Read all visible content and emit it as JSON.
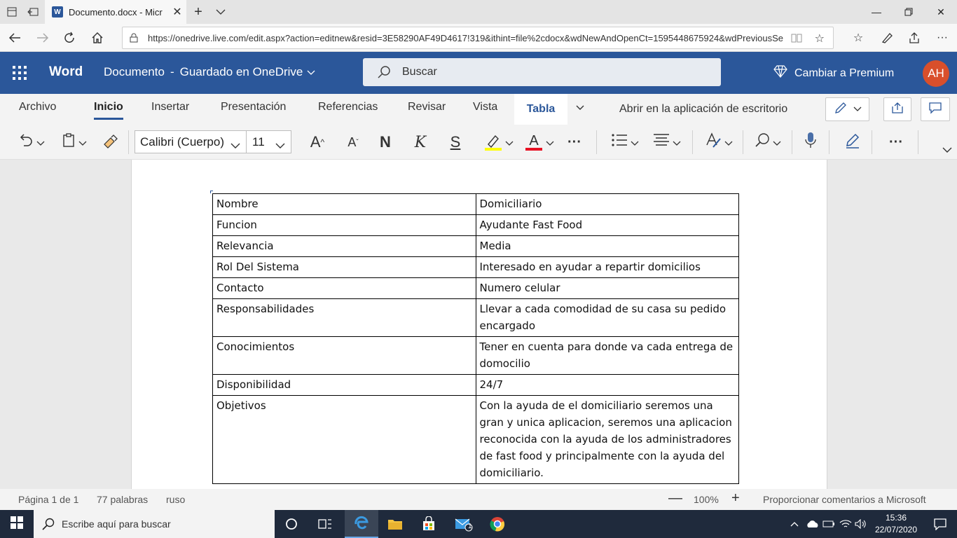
{
  "browser": {
    "tab_title": "Documento.docx - Micr",
    "tab_icon_letter": "W",
    "url": "https://onedrive.live.com/edit.aspx?action=editnew&resid=3E58290AF49D4617!319&ithint=file%2cdocx&wdNewAndOpenCt=1595448675924&wdPreviousSe"
  },
  "word": {
    "app_name": "Word",
    "doc_title": "Documento",
    "save_status": "Guardado en OneDrive",
    "title_separator": "-",
    "search_placeholder": "Buscar",
    "premium_label": "Cambiar a Premium",
    "avatar_initials": "AH",
    "brand_color": "#2b579a"
  },
  "ribbon": {
    "tabs": [
      "Archivo",
      "Inicio",
      "Insertar",
      "Presentación",
      "Referencias",
      "Revisar",
      "Vista",
      "Tabla"
    ],
    "active_tab": "Inicio",
    "context_tab": "Tabla",
    "open_desktop": "Abrir en la aplicación de escritorio",
    "font_name": "Calibri (Cuerpo)",
    "font_size": "11",
    "bold_label": "N",
    "italic_label": "K",
    "strike_label": "S",
    "grow_font": "A",
    "shrink_font": "A",
    "font_color_label": "A",
    "more_label": "···",
    "highlight_color": "#ffff00",
    "font_color": "#e81123"
  },
  "table": {
    "rows": [
      [
        "Nombre",
        "Domiciliario"
      ],
      [
        "Funcion",
        "Ayudante Fast Food"
      ],
      [
        "Relevancia",
        "Media"
      ],
      [
        "Rol Del Sistema",
        "Interesado en ayudar a repartir domicilios"
      ],
      [
        "Contacto",
        "Numero celular"
      ],
      [
        "Responsabilidades",
        "Llevar a cada comodidad de su casa su pedido encargado"
      ],
      [
        "Conocimientos",
        "Tener en cuenta para donde va cada entrega de domocilio"
      ],
      [
        "Disponibilidad",
        "24/7"
      ],
      [
        "Objetivos",
        "Con la ayuda de el domiciliario seremos una gran y unica aplicacion, seremos una aplicacion reconocida con la ayuda de los administradores de fast food y principalmente con la ayuda del domiciliario."
      ]
    ]
  },
  "status": {
    "page": "Página 1 de 1",
    "words": "77 palabras",
    "language": "ruso",
    "zoom": "100%",
    "zoom_minus": "—",
    "zoom_plus": "+",
    "feedback": "Proporcionar comentarios a Microsoft"
  },
  "taskbar": {
    "search_placeholder": "Escribe aquí para buscar",
    "time": "15:36",
    "date": "22/07/2020",
    "mail_badge": "1"
  }
}
